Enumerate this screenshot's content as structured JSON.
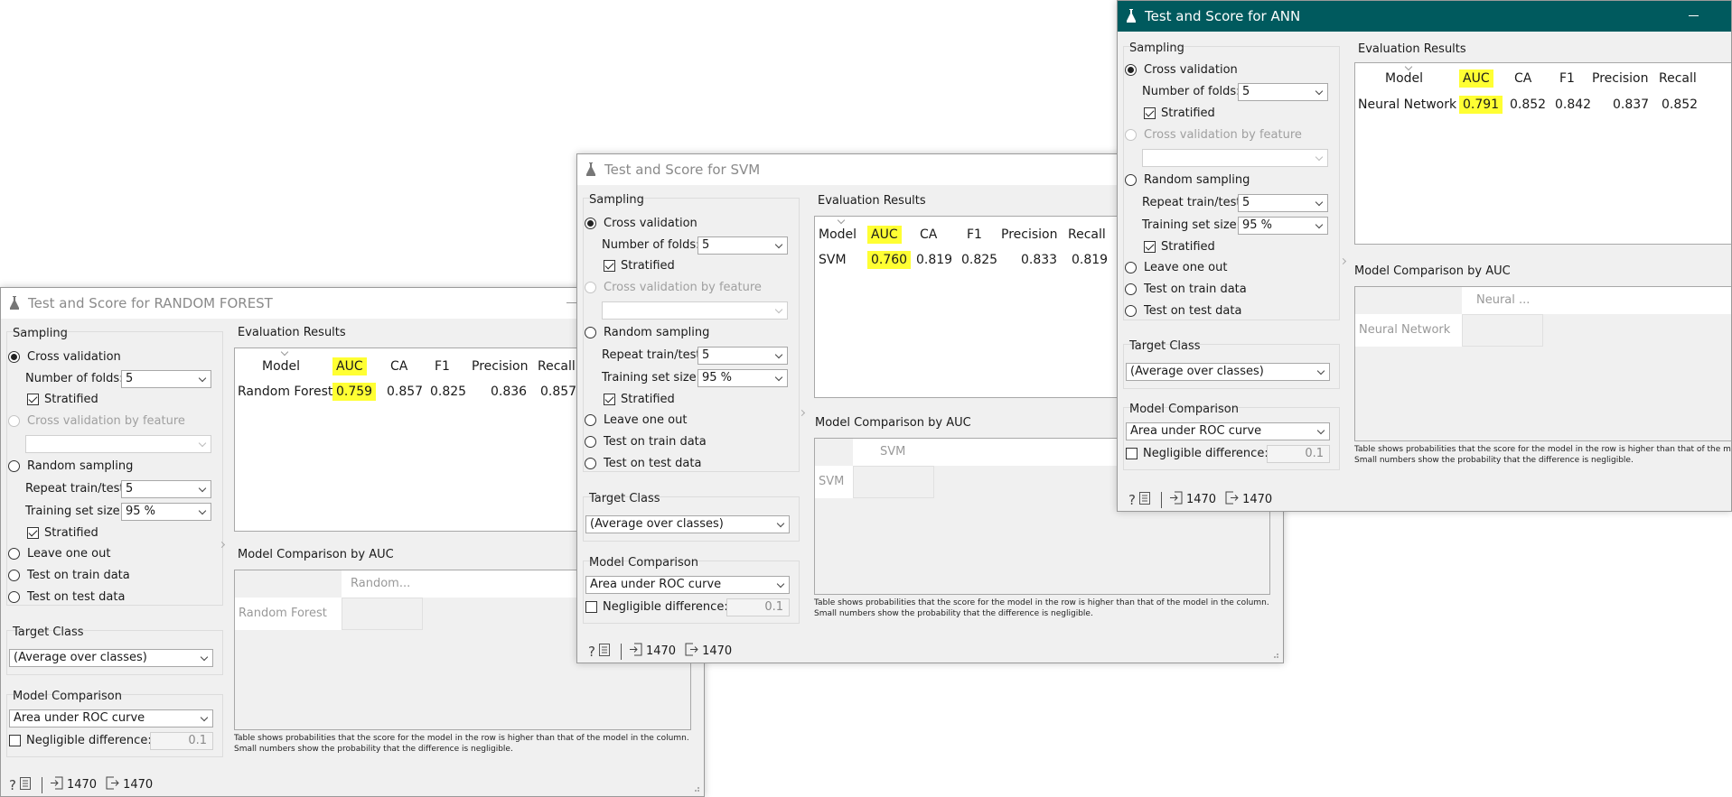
{
  "shared": {
    "sampling_title": "Sampling",
    "cross_validation": "Cross validation",
    "number_of_folds_label": "Number of folds:",
    "folds_value": "5",
    "stratified": "Stratified",
    "cross_validation_by_feature": "Cross validation by feature",
    "random_sampling": "Random sampling",
    "repeat_label": "Repeat train/test:",
    "repeat_value": "5",
    "training_size_label": "Training set size:",
    "training_size_value": "95 %",
    "leave_one_out": "Leave one out",
    "test_on_train": "Test on train data",
    "test_on_test": "Test on test data",
    "target_class_title": "Target Class",
    "target_class_value": "(Average over classes)",
    "model_comparison_title": "Model Comparison",
    "model_comparison_value": "Area under ROC curve",
    "negligible_label": "Negligible difference:",
    "negligible_value": "0.1",
    "evaluation_results_title": "Evaluation Results",
    "comparison_by_auc_title": "Model Comparison by AUC",
    "columns": [
      "Model",
      "AUC",
      "CA",
      "F1",
      "Precision",
      "Recall"
    ],
    "note_line1": "Table shows probabilities that the score for the model in the row is higher than that of the model in the column.",
    "note_line2": "Small numbers show the probability that the difference is negligible.",
    "input_count": "1470",
    "output_count": "1470"
  },
  "windows": {
    "rf": {
      "title": "Test and Score for RANDOM FOREST",
      "row": [
        "Random Forest",
        "0.759",
        "0.857",
        "0.825",
        "0.836",
        "0.857"
      ],
      "cmp_col": "Random...",
      "cmp_row": "Random Forest"
    },
    "svm": {
      "title": "Test and Score for SVM",
      "row": [
        "SVM",
        "0.760",
        "0.819",
        "0.825",
        "0.833",
        "0.819"
      ],
      "cmp_col": "SVM",
      "cmp_row": "SVM"
    },
    "ann": {
      "title": "Test and Score for ANN",
      "row": [
        "Neural Network",
        "0.791",
        "0.852",
        "0.842",
        "0.837",
        "0.852"
      ],
      "cmp_col": "Neural ...",
      "cmp_row": "Neural Network"
    }
  },
  "colors": {
    "active_titlebar": "#005a5e",
    "highlight": "#ffff33",
    "background": "#f0f0f0"
  }
}
